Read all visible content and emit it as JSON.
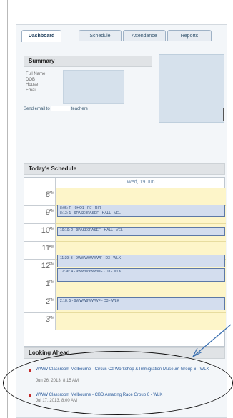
{
  "tabs": [
    {
      "label": "Dashboard",
      "active": true
    },
    {
      "label": "Schedule",
      "active": false
    },
    {
      "label": "Attendance",
      "active": false
    },
    {
      "label": "Reports",
      "active": false
    }
  ],
  "summary": {
    "title": "Summary",
    "fields": [
      "Full Name",
      "DOB",
      "House",
      "Email"
    ],
    "send_email_prefix": "Send email to",
    "send_email_suffix": "teachers"
  },
  "schedule": {
    "title": "Today's Schedule",
    "day_label": "Wed, 19 Jun",
    "hours": [
      {
        "num": "8",
        "ampm": "AM"
      },
      {
        "num": "9",
        "ampm": "AM"
      },
      {
        "num": "10",
        "ampm": "AM"
      },
      {
        "num": "11",
        "ampm": "AM"
      },
      {
        "num": "12",
        "ampm": "PM"
      },
      {
        "num": "1",
        "ampm": "PM"
      },
      {
        "num": "2",
        "ampm": "PM"
      },
      {
        "num": "3",
        "ampm": "PM"
      }
    ],
    "events": [
      {
        "text": "8:05: R - 9HO1 - R7 - RIR"
      },
      {
        "text": "8:13: 1 - 9PASE9PASEF - HALL - VEL"
      },
      {
        "text": "10:10: 2 - 9PASE9PASEF - HALL - VEL"
      },
      {
        "text": "11:39: 3 - 9WWW9WWWF - D3 - WLK"
      },
      {
        "text": "12:36: 4 - 9WWW9WWWF - D3 - WLK"
      },
      {
        "text": "2:18: 5 - 9WWW9WWWF - D3 - WLK"
      }
    ]
  },
  "looking_ahead": {
    "title": "Looking Ahead",
    "items": [
      {
        "title": "WWW Classroom Melbourne - Circus Oz Workshop & Immigration Museum Group 6 - WLK",
        "date": "Jun 26, 2013, 8:15 AM"
      },
      {
        "title": "WWW Classroom Melbourne - CBD Amazing Race Group 6 - WLK",
        "date": "Jul 17, 2013, 8:00 AM"
      }
    ]
  },
  "colors": {
    "event_fill": "#d3ddee",
    "event_border": "#5c78a6",
    "slot_fill": "#fdf5c9",
    "bullet": "#c52a2a",
    "link": "#2c5c9c",
    "annotation": "#3a6fb0"
  }
}
